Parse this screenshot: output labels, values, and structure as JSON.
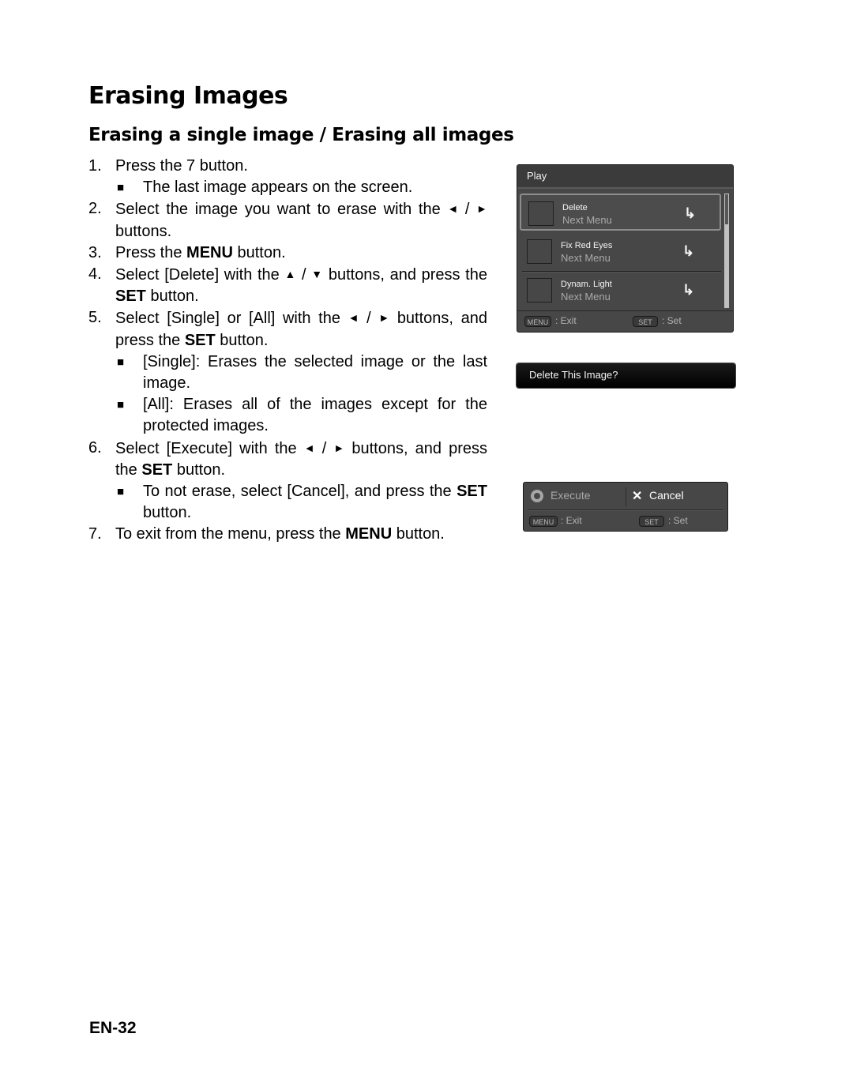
{
  "page": {
    "title": "Erasing Images",
    "subtitle": "Erasing a single image / Erasing all images",
    "page_number": "EN-32"
  },
  "steps": [
    {
      "num": "1.",
      "parts": [
        "Press the 7   button."
      ],
      "bullets": [
        "The last image appears on the screen."
      ]
    },
    {
      "num": "2.",
      "text_before": "Select the image you want to erase with the",
      "icons": [
        "left-triangle",
        "right-triangle"
      ],
      "text_after": "buttons."
    },
    {
      "num": "3.",
      "text_before": "Press the",
      "bold": "MENU",
      "text_after": "button."
    },
    {
      "num": "4.",
      "text_before": "Select [Delete] with the",
      "icons": [
        "up-triangle",
        "down-triangle"
      ],
      "text_mid": "buttons, and press the",
      "bold": "SET",
      "text_after": "button."
    },
    {
      "num": "5.",
      "text_before": "Select [Single] or [All] with the",
      "icons": [
        "left-triangle",
        "right-triangle"
      ],
      "text_mid": "buttons, and press the",
      "bold": "SET",
      "text_after": "button.",
      "bullets": [
        "[Single]: Erases the selected image or the last image.",
        "[All]: Erases all of the images except for the protected images."
      ]
    },
    {
      "num": "6.",
      "text_before": "Select [Execute] with the",
      "icons": [
        "left-triangle",
        "right-triangle"
      ],
      "text_mid": "buttons, and press the",
      "bold": "SET",
      "text_after": "button.",
      "bullets_rich": [
        {
          "before": "To not erase, select [Cancel], and press the",
          "bold": "SET",
          "after": "button."
        }
      ]
    },
    {
      "num": "7.",
      "text_before": "To exit from the menu, press the",
      "bold": "MENU",
      "text_after": "button."
    }
  ],
  "symbols": {
    "left": "◄",
    "right": "►",
    "up": "▲",
    "down": "▼",
    "slash": "/",
    "bullet": "■",
    "submenu_arrow": "↳",
    "cancel_x": "✕"
  },
  "screen_play_menu": {
    "title": "Play",
    "items": [
      {
        "label": "Delete",
        "sub": "Next Menu",
        "selected": true
      },
      {
        "label": "Fix Red Eyes",
        "sub": "Next Menu",
        "selected": false
      },
      {
        "label": "Dynam. Light",
        "sub": "Next Menu",
        "selected": false
      }
    ],
    "hints": [
      {
        "key": "MENU",
        "text": ": Exit"
      },
      {
        "key": "SET",
        "text": ": Set"
      }
    ]
  },
  "screen_confirm": {
    "prompt": "Delete This Image?"
  },
  "screen_execute": {
    "options": [
      {
        "label": "Execute",
        "selected": false
      },
      {
        "label": "Cancel",
        "selected": true
      }
    ],
    "hints": [
      {
        "key": "MENU",
        "text": ": Exit"
      },
      {
        "key": "SET",
        "text": ": Set"
      }
    ]
  },
  "colors": {
    "screen_bg": "#474747",
    "screen_text": "#f4f4f4",
    "screen_subtext": "#a9a9a9",
    "confirm_bg": "#000000"
  }
}
